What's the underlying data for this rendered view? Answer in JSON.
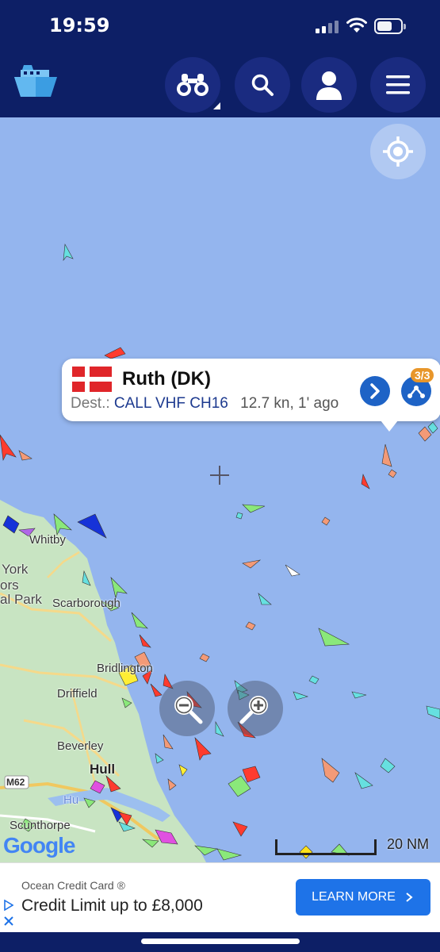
{
  "status_bar": {
    "time": "19:59"
  },
  "header": {
    "logo_icon": "ship-logo-icon",
    "buttons": [
      "binoculars-icon",
      "search-icon",
      "user-icon",
      "menu-icon"
    ]
  },
  "map": {
    "towns": [
      "Whitby",
      "York",
      "ors",
      "al Park",
      "Scarborough",
      "Bridlington",
      "Driffield",
      "Beverley",
      "Hull",
      "Scunthorpe",
      "M62",
      "Hu"
    ],
    "scale_label": "20 NM",
    "attribution": "Google"
  },
  "popup": {
    "flag": "denmark-flag",
    "vessel_name": "Ruth (DK)",
    "dest_label": "Dest.:",
    "destination": "CALL VHF CH16",
    "speed_time": "12.7 kn, 1' ago",
    "count": "3/3"
  },
  "ad": {
    "brand": "Ocean Credit Card ®",
    "headline": "Credit Limit up to £8,000",
    "cta": "LEARN MORE"
  },
  "colors": {
    "header": "#0d1f66",
    "sea": "#94b5ee",
    "land": "#c7e3c0",
    "accent": "#1e63c6"
  }
}
